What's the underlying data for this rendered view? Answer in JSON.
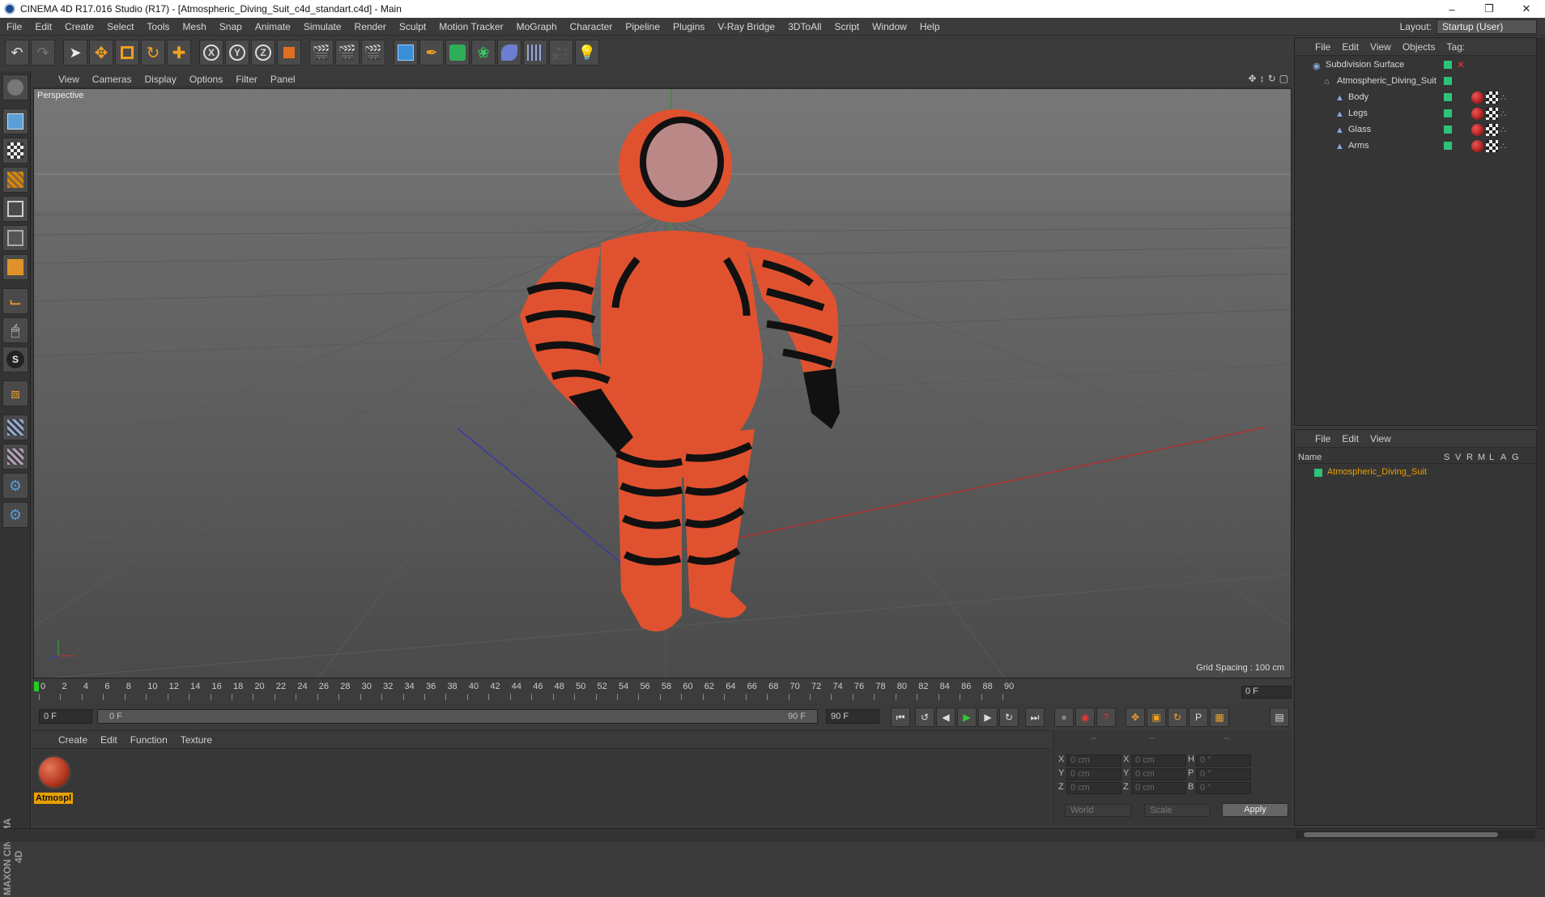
{
  "window": {
    "title": "CINEMA 4D R17.016 Studio (R17) - [Atmospheric_Diving_Suit_c4d_standart.c4d] - Main"
  },
  "menubar": {
    "items": [
      "File",
      "Edit",
      "Create",
      "Select",
      "Tools",
      "Mesh",
      "Snap",
      "Animate",
      "Simulate",
      "Render",
      "Sculpt",
      "Motion Tracker",
      "MoGraph",
      "Character",
      "Pipeline",
      "Plugins",
      "V-Ray Bridge",
      "3DToAll",
      "Script",
      "Window",
      "Help"
    ],
    "layout_label": "Layout:",
    "layout_value": "Startup (User)"
  },
  "toolbar": {
    "axis_x": "X",
    "axis_y": "Y",
    "axis_z": "Z"
  },
  "viewport": {
    "menu": [
      "View",
      "Cameras",
      "Display",
      "Options",
      "Filter",
      "Panel"
    ],
    "label": "Perspective",
    "grid_spacing": "Grid Spacing : 100 cm"
  },
  "timeline": {
    "ticks": [
      "0",
      "2",
      "4",
      "6",
      "8",
      "10",
      "12",
      "14",
      "16",
      "18",
      "20",
      "22",
      "24",
      "26",
      "28",
      "30",
      "32",
      "34",
      "36",
      "38",
      "40",
      "42",
      "44",
      "46",
      "48",
      "50",
      "52",
      "54",
      "56",
      "58",
      "60",
      "62",
      "64",
      "66",
      "68",
      "70",
      "72",
      "74",
      "76",
      "78",
      "80",
      "82",
      "84",
      "86",
      "88",
      "90"
    ],
    "current_frame": "0 F"
  },
  "transport": {
    "start": "0 F",
    "slider_left": "0 F",
    "slider_right": "90 F",
    "end": "90 F"
  },
  "material_manager": {
    "menu": [
      "Create",
      "Edit",
      "Function",
      "Texture"
    ],
    "material_name": "Atmospl"
  },
  "coordinates": {
    "header": [
      "--",
      "--",
      "--"
    ],
    "rows": [
      {
        "a": "X",
        "av": "0 cm",
        "b": "X",
        "bv": "0 cm",
        "c": "H",
        "cv": "0 °"
      },
      {
        "a": "Y",
        "av": "0 cm",
        "b": "Y",
        "bv": "0 cm",
        "c": "P",
        "cv": "0 °"
      },
      {
        "a": "Z",
        "av": "0 cm",
        "b": "Z",
        "bv": "0 cm",
        "c": "B",
        "cv": "0 °"
      }
    ],
    "mode1": "World",
    "mode2": "Scale",
    "apply": "Apply"
  },
  "object_manager": {
    "menu": [
      "File",
      "Edit",
      "View",
      "Objects",
      "Tag:"
    ],
    "objects": [
      {
        "name": "Subdivision Surface"
      },
      {
        "name": "Atmospheric_Diving_Suit"
      },
      {
        "name": "Body"
      },
      {
        "name": "Legs"
      },
      {
        "name": "Glass"
      },
      {
        "name": "Arms"
      }
    ]
  },
  "attribute_manager": {
    "menu": [
      "File",
      "Edit",
      "View"
    ],
    "columns": [
      "Name",
      "S",
      "V",
      "R",
      "M",
      "L",
      "A",
      "G"
    ],
    "row_name": "Atmospheric_Diving_Suit"
  },
  "brand": "MAXON CINEMA 4D",
  "colors": {
    "accent_orange": "#e8a000",
    "object_green": "#2ec27a",
    "suit_orange": "#e0522f"
  }
}
